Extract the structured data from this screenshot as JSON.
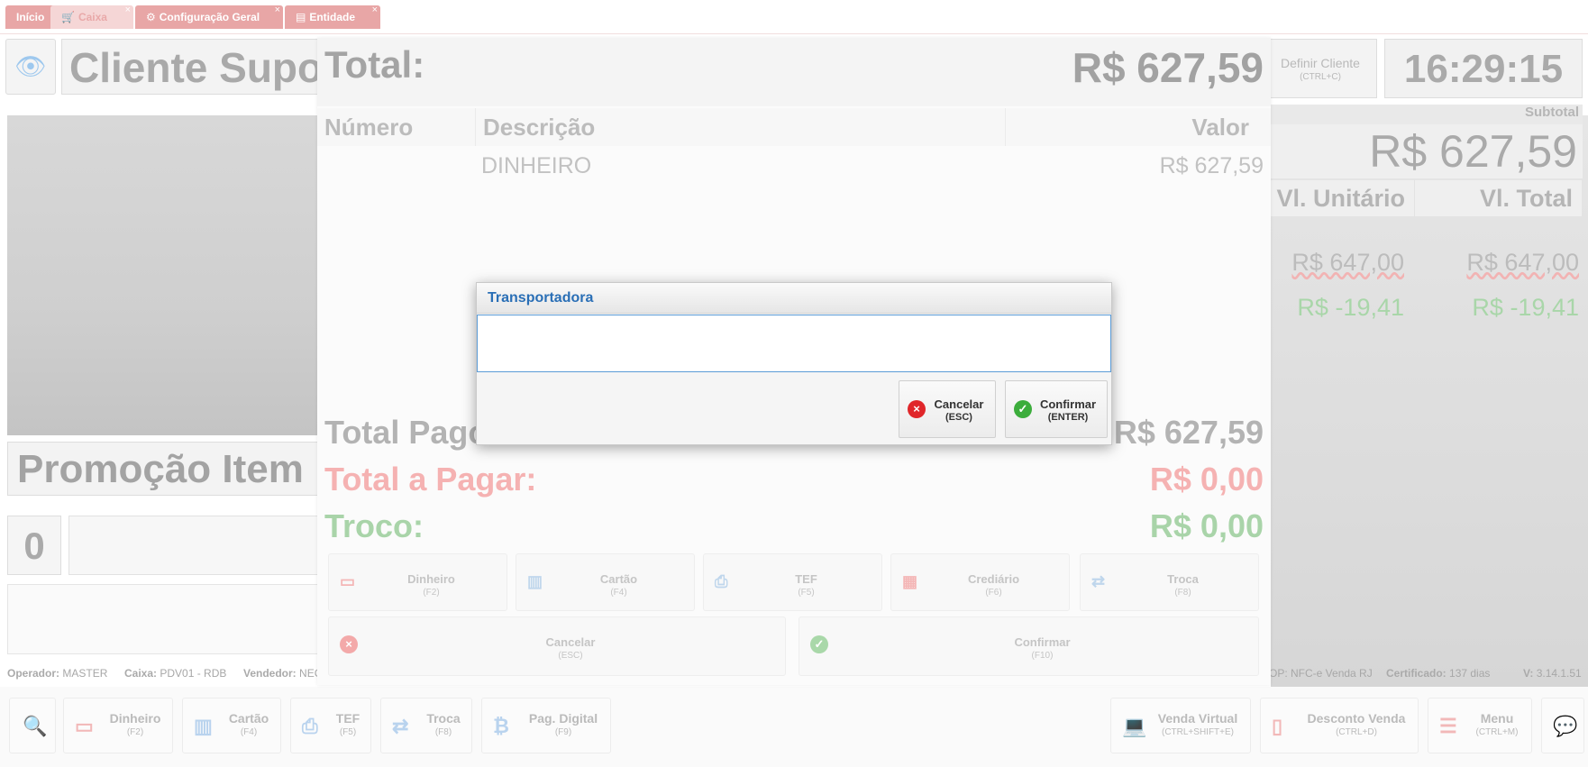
{
  "tabs": [
    {
      "label": "Início"
    },
    {
      "label": "Caixa",
      "icon": "cart-icon"
    },
    {
      "label": "Configuração Geral",
      "icon": "gear-icon"
    },
    {
      "label": "Entidade",
      "icon": "id-card-icon"
    }
  ],
  "header": {
    "cliente": "Cliente Supo",
    "definir_cliente": "Definir Cliente",
    "definir_cliente_shortcut": "(CTRL+C)",
    "clock": "16:29:15"
  },
  "items": {
    "subtotal_label": "Subtotal",
    "subtotal_value": "R$ 627,59",
    "col_unit": "Vl. Unitário",
    "col_total": "Vl. Total",
    "rows": [
      {
        "unit": "R$ 647,00",
        "total": "R$ 647,00"
      },
      {
        "unit": "R$ -19,41",
        "total": "R$ -19,41"
      }
    ]
  },
  "promo": "Promoção Item",
  "quantity": "0",
  "status": {
    "operador_label": "Operador:",
    "operador": "MASTER",
    "caixa_label": "Caixa:",
    "caixa": "PDV01 - RDB",
    "vendedor_label": "Vendedor:",
    "vendedor": "NEC",
    "top": "OP: NFC-e Venda RJ",
    "certificado_label": "Certificado:",
    "certificado": "137 dias",
    "versao_label": "V:",
    "versao": "3.14.1.51"
  },
  "bottom_buttons": [
    {
      "label": "Dinheiro",
      "shortcut": "(F2)"
    },
    {
      "label": "Cartão",
      "shortcut": "(F4)"
    },
    {
      "label": "TEF",
      "shortcut": "(F5)"
    },
    {
      "label": "Troca",
      "shortcut": "(F8)"
    },
    {
      "label": "Pag. Digital",
      "shortcut": "(F9)"
    },
    {
      "label": "Venda Virtual",
      "shortcut": "(CTRL+SHIFT+E)"
    },
    {
      "label": "Desconto Venda",
      "shortcut": "(CTRL+D)"
    },
    {
      "label": "Menu",
      "shortcut": "(CTRL+M)"
    }
  ],
  "payment": {
    "total_label": "Total:",
    "total_value": "R$ 627,59",
    "col_numero": "Número",
    "col_descricao": "Descrição",
    "col_valor": "Valor",
    "rows": [
      {
        "numero": "",
        "descricao": "DINHEIRO",
        "valor": "R$ 627,59"
      }
    ],
    "total_pago_label": "Total Pago",
    "total_pago_value": "R$ 627,59",
    "total_a_pagar_label": "Total a Pagar:",
    "total_a_pagar_value": "R$ 0,00",
    "troco_label": "Troco:",
    "troco_value": "R$ 0,00",
    "methods": [
      {
        "label": "Dinheiro",
        "shortcut": "(F2)"
      },
      {
        "label": "Cartão",
        "shortcut": "(F4)"
      },
      {
        "label": "TEF",
        "shortcut": "(F5)"
      },
      {
        "label": "Crediário",
        "shortcut": "(F6)"
      },
      {
        "label": "Troca",
        "shortcut": "(F8)"
      }
    ],
    "cancel_label": "Cancelar",
    "cancel_shortcut": "(ESC)",
    "confirm_label": "Confirmar",
    "confirm_shortcut": "(F10)"
  },
  "dialog": {
    "title": "Transportadora",
    "input_value": "",
    "cancel_label": "Cancelar",
    "cancel_shortcut": "(ESC)",
    "confirm_label": "Confirmar",
    "confirm_shortcut": "(ENTER)"
  },
  "colors": {
    "accent_blue": "#2a6fb6",
    "tab_red": "#e8a6a6",
    "cancel_red": "#e0262a",
    "confirm_green": "#3cad3c"
  }
}
